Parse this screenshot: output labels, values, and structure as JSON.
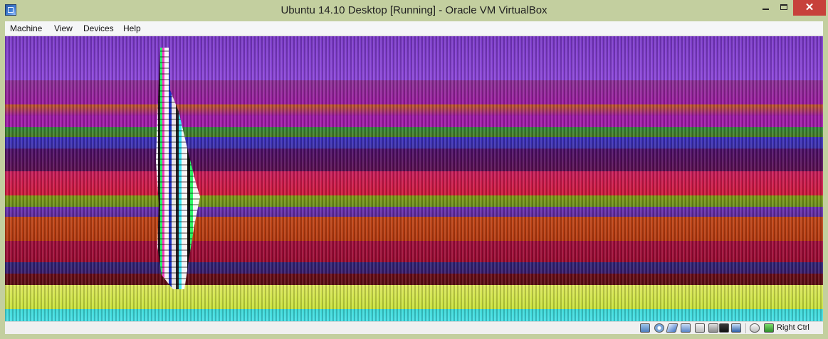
{
  "window": {
    "title": "Ubuntu 14.10 Desktop [Running] - Oracle VM VirtualBox",
    "controls": {
      "close": "✕"
    }
  },
  "menu": {
    "items": [
      "Machine",
      "View",
      "Devices",
      "Help"
    ]
  },
  "statusbar": {
    "icons": [
      "hard-disk-icon",
      "optical-drive-icon",
      "usb-icon",
      "network-icon",
      "shared-folders-icon",
      "display-icon",
      "video-capture-icon",
      "cpu-icon",
      "mouse-integration-icon",
      "keyboard-capture-icon"
    ],
    "host_key": "Right Ctrl"
  },
  "colors": {
    "titlebar": "#c3cf9f",
    "close_button": "#c7413b",
    "menubar": "#f5f6f7"
  }
}
